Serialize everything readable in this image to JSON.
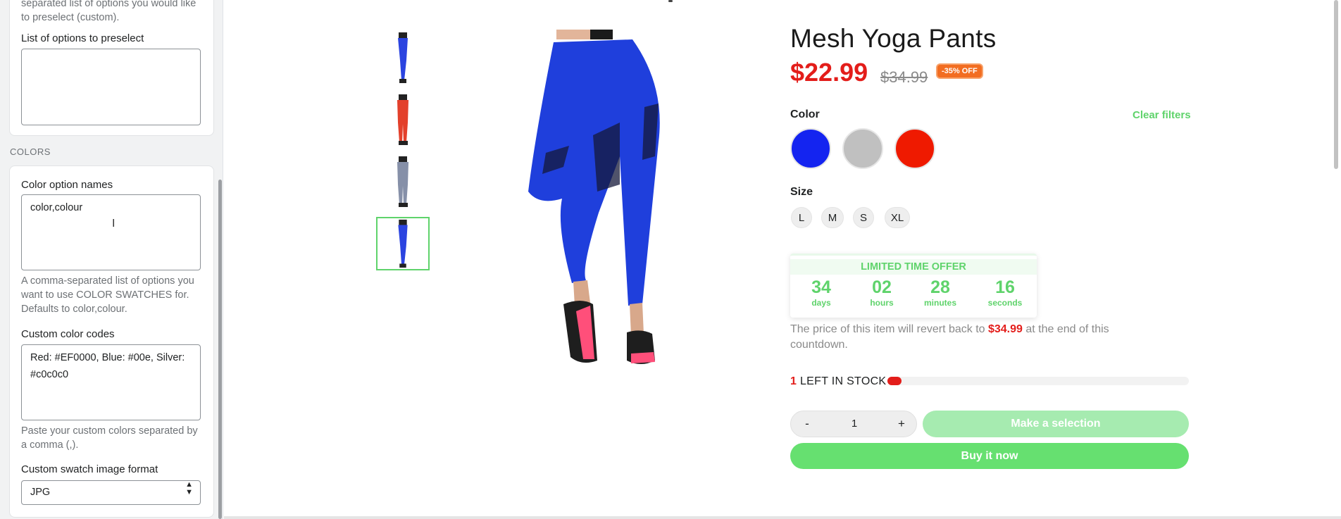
{
  "left_panel": {
    "top_help": "separated list of options you would like to preselect (custom).",
    "preselect_label": "List of options to preselect",
    "preselect_value": "",
    "section_colors": "COLORS",
    "color_option_names_label": "Color option names",
    "color_option_names_value": "color,colour",
    "color_option_names_help": "A comma-separated list of options you want to use COLOR SWATCHES for. Defaults to color,colour.",
    "custom_codes_label": "Custom color codes",
    "custom_codes_value": "Red: #EF0000, Blue: #00e, Silver: #c0c0c0",
    "custom_codes_help": "Paste your custom colors separated by a comma (,).",
    "swatch_format_label": "Custom swatch image format",
    "swatch_format_value": "JPG"
  },
  "product": {
    "title": "Mesh Yoga Pants",
    "price": "$22.99",
    "compare_price": "$34.99",
    "discount_badge": "-35% OFF",
    "color_label": "Color",
    "clear_filters": "Clear filters",
    "color_swatches": [
      {
        "name": "Blue",
        "color": "#1424f0"
      },
      {
        "name": "Silver",
        "color": "#c0c0c0"
      },
      {
        "name": "Red",
        "color": "#ef1a00"
      }
    ],
    "size_label": "Size",
    "sizes": [
      "L",
      "M",
      "S",
      "XL"
    ],
    "thumbnail_colors": [
      "#2b44e0",
      "#e3402b",
      "#8690a8",
      "#2b44e0"
    ]
  },
  "offer": {
    "title": "LIMITED TIME OFFER",
    "countdown": [
      {
        "value": "34",
        "unit": "days"
      },
      {
        "value": "02",
        "unit": "hours"
      },
      {
        "value": "28",
        "unit": "minutes"
      },
      {
        "value": "16",
        "unit": "seconds"
      }
    ],
    "revert_before": "The price of this item will revert back to ",
    "revert_price": "$34.99",
    "revert_after": " at the end of this countdown."
  },
  "stock": {
    "count": "1",
    "text": " LEFT IN STOCK",
    "fill_fraction": 0.04
  },
  "cart": {
    "minus": "-",
    "quantity": "1",
    "plus": "+",
    "make_selection": "Make a selection",
    "buy_now": "Buy it now"
  },
  "colors": {
    "accent_green": "#5fd36b",
    "sale_red": "#e31d1a",
    "badge_orange": "#f26d21"
  }
}
